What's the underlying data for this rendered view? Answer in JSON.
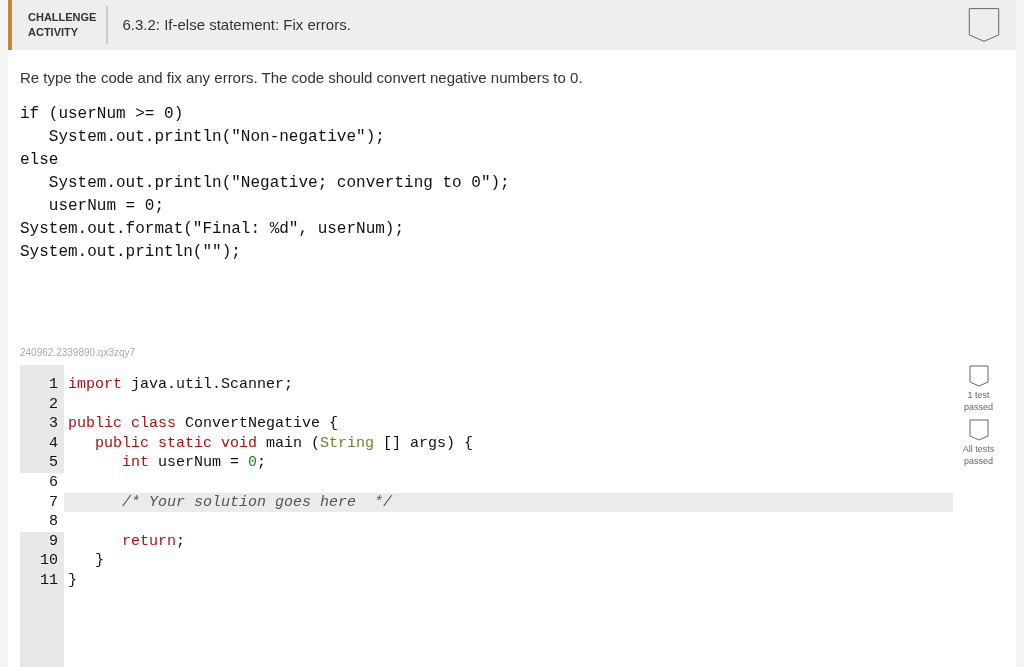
{
  "header": {
    "badge_lines": [
      "CHALLENGE",
      "ACTIVITY"
    ],
    "title": "6.3.2: If-else statement: Fix errors."
  },
  "instructions": "Re type the code and fix any errors. The code should convert negative numbers to 0.",
  "given_code": [
    "if (userNum >= 0)",
    "   System.out.println(\"Non-negative\");",
    "else",
    "   System.out.println(\"Negative; converting to 0\");",
    "   userNum = 0;",
    "System.out.format(\"Final: %d\", userNum);",
    "System.out.println(\"\");"
  ],
  "editor": {
    "id_label": "240962.2339890.qx3zqy7",
    "lines": [
      {
        "number": "1",
        "readonly": true,
        "active": false,
        "tokens": [
          {
            "kind": "keyword",
            "text": "import"
          },
          {
            "kind": "plain",
            "text": " java.util.Scanner;"
          }
        ]
      },
      {
        "number": "2",
        "readonly": true,
        "active": false
      },
      {
        "number": "3",
        "readonly": true,
        "active": false,
        "tokens": [
          {
            "kind": "keyword",
            "text": "public class"
          },
          {
            "kind": "plain",
            "text": " ConvertNegative {"
          }
        ]
      },
      {
        "number": "4",
        "readonly": true,
        "active": false,
        "tokens": [
          {
            "kind": "keyword",
            "text": "   public static void"
          },
          {
            "kind": "plain",
            "text": " main ("
          },
          {
            "kind": "type",
            "text": "String"
          },
          {
            "kind": "plain",
            "text": " [] args) {"
          }
        ]
      },
      {
        "number": "5",
        "readonly": true,
        "active": false,
        "tokens": [
          {
            "kind": "keyword",
            "text": "      int"
          },
          {
            "kind": "plain",
            "text": " userNum = "
          },
          {
            "kind": "number",
            "text": "0"
          },
          {
            "kind": "plain",
            "text": ";"
          }
        ]
      },
      {
        "number": "6",
        "readonly": false,
        "active": false
      },
      {
        "number": "7",
        "readonly": false,
        "active": true,
        "tokens": [
          {
            "kind": "comment",
            "text": "      /* Your solution goes here  */"
          }
        ]
      },
      {
        "number": "8",
        "readonly": false,
        "active": false
      },
      {
        "number": "9",
        "readonly": true,
        "active": false,
        "tokens": [
          {
            "kind": "keyword",
            "text": "      return"
          },
          {
            "kind": "plain",
            "text": ";"
          }
        ]
      },
      {
        "number": "10",
        "readonly": true,
        "active": false,
        "tokens": [
          {
            "kind": "plain",
            "text": "   }"
          }
        ]
      },
      {
        "number": "11",
        "readonly": true,
        "active": false,
        "tokens": [
          {
            "kind": "plain",
            "text": "}"
          }
        ]
      }
    ]
  },
  "tests": [
    {
      "label": "1 test passed",
      "passed": false
    },
    {
      "label": "All tests passed",
      "passed": false
    }
  ]
}
